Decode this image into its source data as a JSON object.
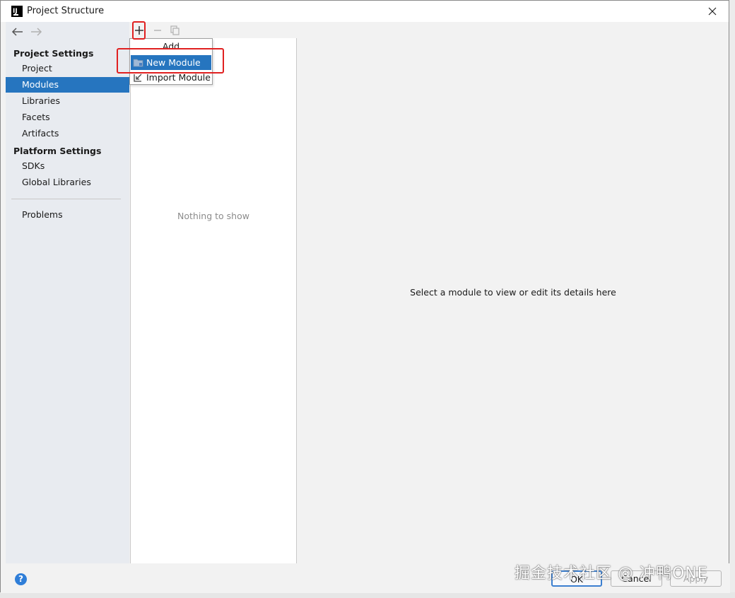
{
  "window": {
    "title": "Project Structure"
  },
  "sidebar": {
    "project_settings_header": "Project Settings",
    "platform_settings_header": "Platform Settings",
    "items": [
      {
        "label": "Project"
      },
      {
        "label": "Modules"
      },
      {
        "label": "Libraries"
      },
      {
        "label": "Facets"
      },
      {
        "label": "Artifacts"
      },
      {
        "label": "SDKs"
      },
      {
        "label": "Global Libraries"
      },
      {
        "label": "Problems"
      }
    ],
    "selected": "Modules"
  },
  "toolbar": {
    "icons": [
      "add-icon",
      "remove-icon",
      "copy-icon"
    ]
  },
  "popup": {
    "title": "Add",
    "items": [
      {
        "label": "New Module",
        "icon": "module-folder-icon"
      },
      {
        "label": "Import Module",
        "icon": "import-icon"
      }
    ]
  },
  "list": {
    "empty_text": "Nothing to show"
  },
  "detail": {
    "placeholder": "Select a module to view or edit its details here"
  },
  "buttons": {
    "ok": "OK",
    "cancel": "Cancel",
    "apply": "Apply",
    "help": "?"
  },
  "watermark": "掘金技术社区 @ 冲鸭ONE",
  "colors": {
    "selection": "#2675bf",
    "highlight_box": "#e02020",
    "sidebar_bg": "#e8ebf0"
  }
}
